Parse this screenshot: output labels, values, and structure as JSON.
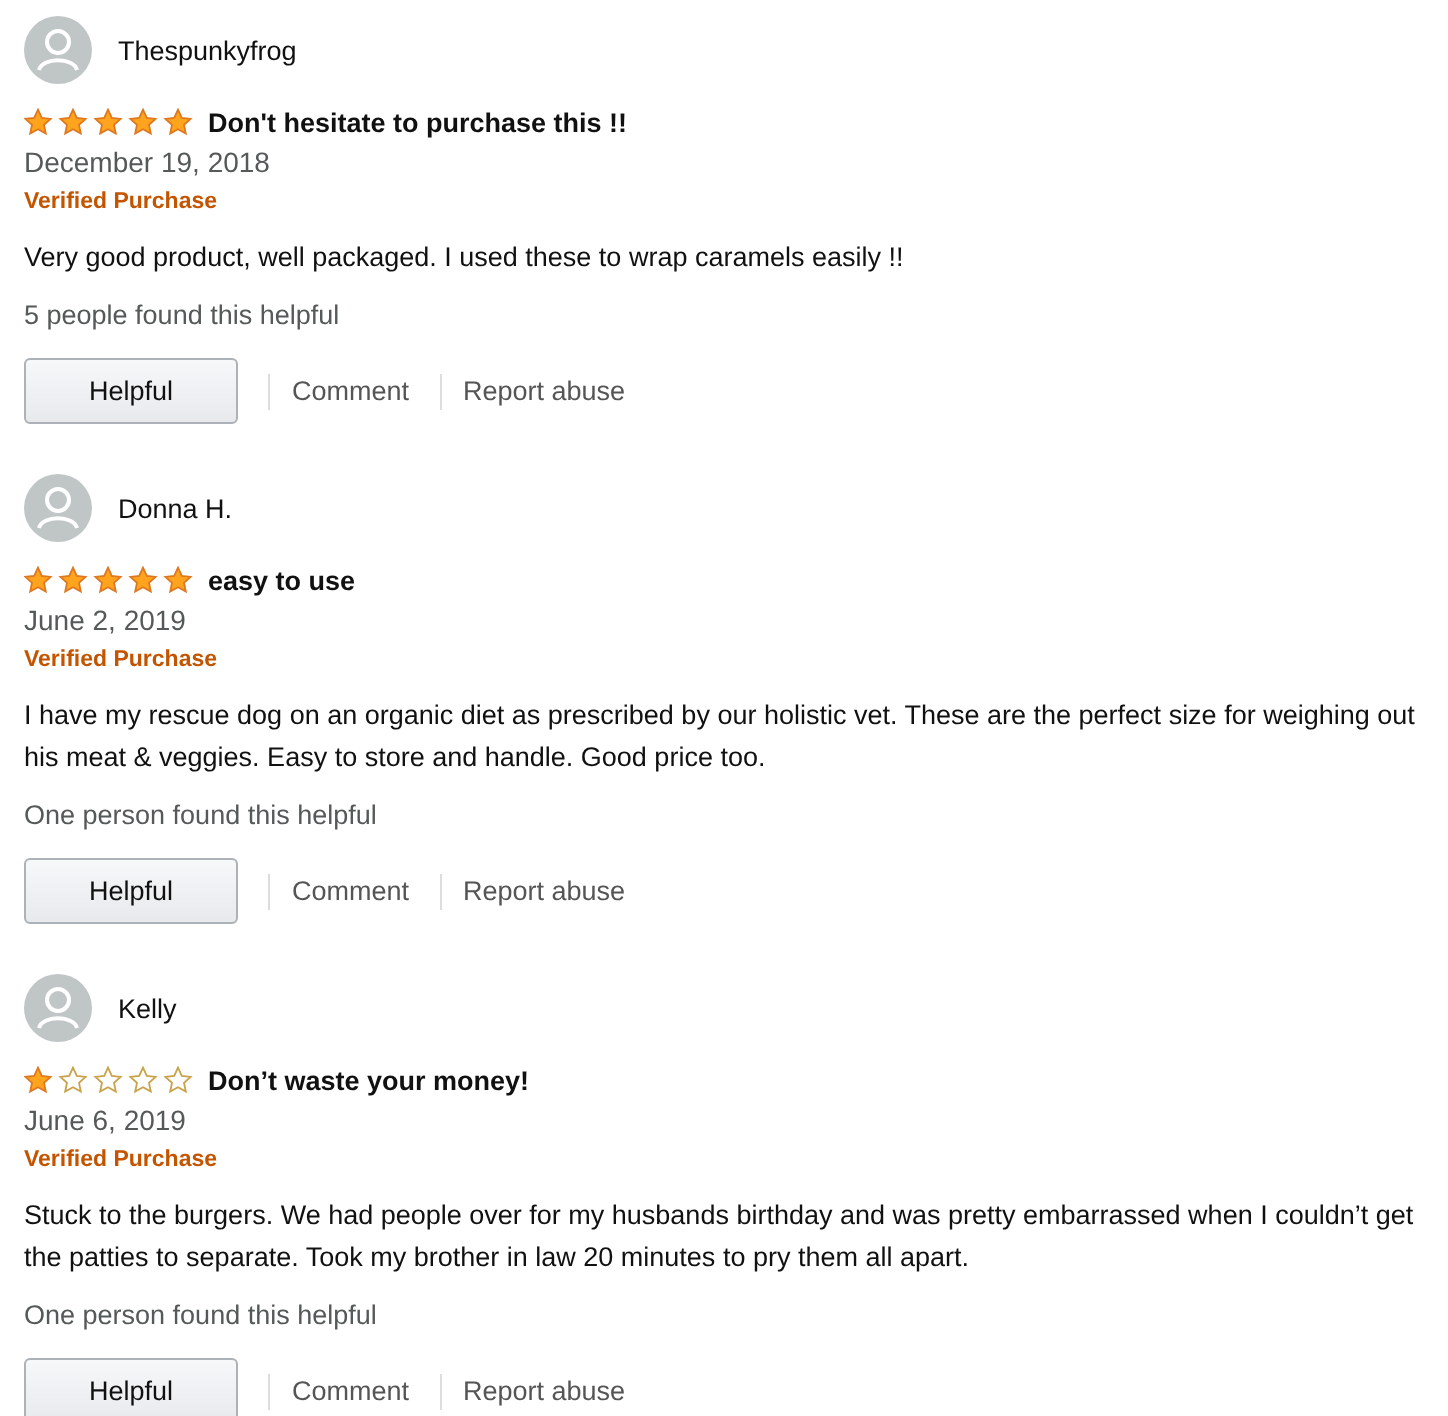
{
  "reviews": [
    {
      "author": "Thespunkyfrog",
      "stars": 5,
      "title": "Don't hesitate to purchase this !!",
      "date": "December 19, 2018",
      "badge": "Verified Purchase",
      "body": "Very good product, well packaged. I used these to wrap caramels easily !!",
      "helpful_count": "5 people found this helpful",
      "buttons": [
        "Helpful"
      ],
      "links": [
        "Comment",
        "Report abuse"
      ]
    },
    {
      "author": "Donna H.",
      "stars": 5,
      "title": "easy to use",
      "date": "June 2, 2019",
      "badge": "Verified Purchase",
      "body": "I have my rescue dog on an organic diet as prescribed by our holistic vet. These are the perfect size for weighing out his meat & veggies. Easy to store and handle. Good price too.",
      "helpful_count": "One person found this helpful",
      "buttons": [
        "Helpful"
      ],
      "links": [
        "Comment",
        "Report abuse"
      ]
    },
    {
      "author": "Kelly",
      "stars": 1,
      "title": "Don’t waste your money!",
      "date": "June 6, 2019",
      "badge": "Verified Purchase",
      "body": "Stuck to the burgers. We had people over for my husbands birthday and was pretty embarrassed when I couldn’t get the patties to separate. Took my brother in law 20 minutes to pry them all apart.",
      "helpful_count": "One person found this helpful",
      "buttons": [
        "Helpful"
      ],
      "links": [
        "Comment",
        "Report abuse"
      ]
    }
  ]
}
